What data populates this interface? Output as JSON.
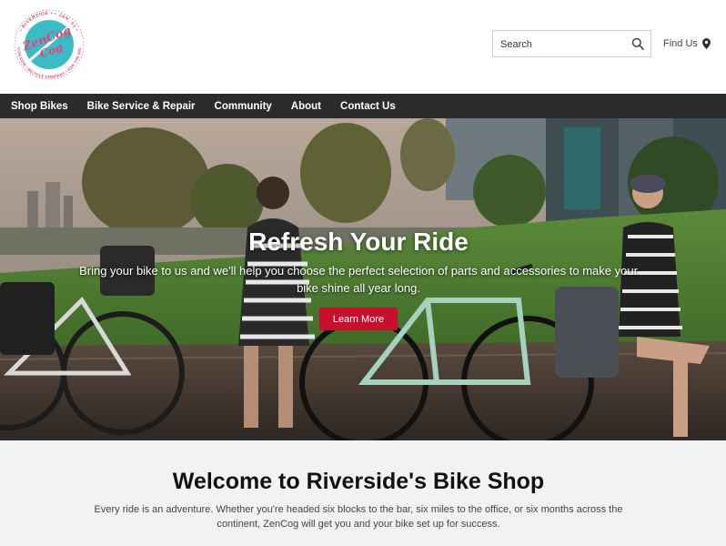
{
  "brand": {
    "logo_text": "ZenCog",
    "logo_ring_top": "• RIVERSIDE • • JAN. 01 •",
    "logo_ring_bottom": "ZENCOG.COM • BICYCLE COMPANY • FOR THE WORLD",
    "colors": {
      "teal": "#3bbcc4",
      "pink": "#e2457a"
    }
  },
  "header": {
    "search_placeholder": "Search",
    "find_us_label": "Find Us"
  },
  "nav": {
    "items": [
      "Shop Bikes",
      "Bike Service & Repair",
      "Community",
      "About",
      "Contact Us"
    ]
  },
  "hero": {
    "title": "Refresh Your Ride",
    "subtitle": "Bring your bike to us and we'll help you choose the perfect selection of parts and accessories to make your bike shine all year long.",
    "cta_label": "Learn More",
    "cta_color": "#c8102e"
  },
  "welcome": {
    "title": "Welcome to Riverside's Bike Shop",
    "body": "Every ride is an adventure. Whether you're headed six blocks to the bar, six miles to the office, or six months across the continent, ZenCog will get you and your bike set up for success."
  }
}
